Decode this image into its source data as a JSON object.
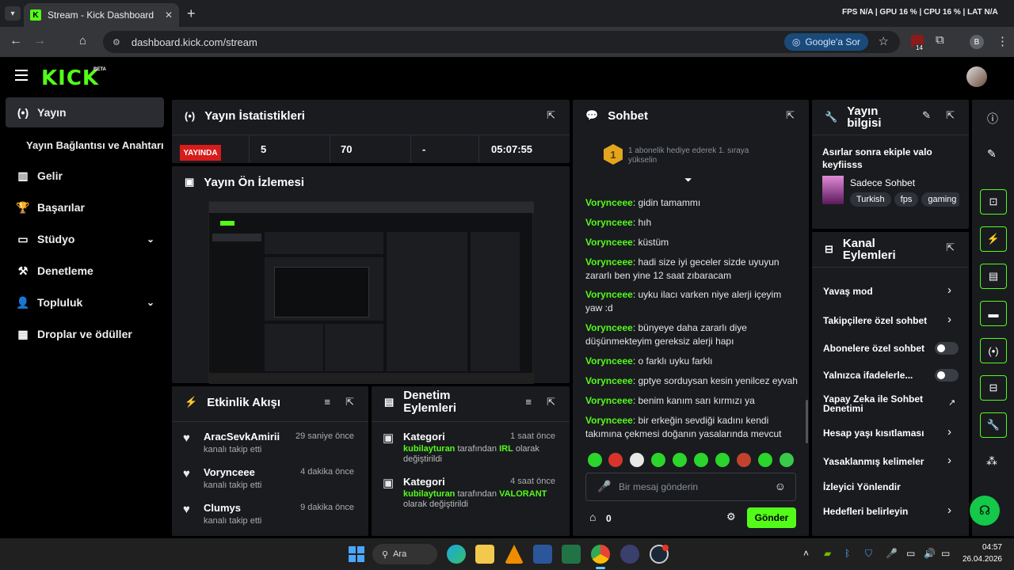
{
  "browser": {
    "tab_title": "Stream - Kick Dashboard",
    "url": "dashboard.kick.com/stream",
    "google_btn": "Google'a Sor",
    "badge_count": "14",
    "profile_letter": "B",
    "perf": "FPS N/A | GPU 16 % | CPU 16 % | LAT N/A"
  },
  "header": {
    "logo": "KICK",
    "beta": "BETA"
  },
  "sidebar": {
    "items": [
      {
        "label": "Yayın",
        "icon": "(•)"
      },
      {
        "label": "Yayın Bağlantısı ve Anahtarı",
        "icon": ""
      },
      {
        "label": "Gelir",
        "icon": "▥"
      },
      {
        "label": "Başarılar",
        "icon": "🏆"
      },
      {
        "label": "Stüdyo",
        "icon": "▭"
      },
      {
        "label": "Denetleme",
        "icon": "⚒"
      },
      {
        "label": "Topluluk",
        "icon": "👤"
      },
      {
        "label": "Droplar ve ödüller",
        "icon": "▦"
      }
    ]
  },
  "stats": {
    "title": "Yayın İstatistikleri",
    "live": "YAYINDA",
    "viewers": "5",
    "followers": "70",
    "subs": "-",
    "duration": "05:07:55"
  },
  "preview": {
    "title": "Yayın Ön İzlemesi"
  },
  "activity": {
    "title": "Etkinlik Akışı",
    "items": [
      {
        "name": "AracSevkAmirii",
        "sub": "kanalı takip etti",
        "time": "29 saniye önce"
      },
      {
        "name": "Vorynceee",
        "sub": "kanalı takip etti",
        "time": "4 dakika önce"
      },
      {
        "name": "Clumys",
        "sub": "kanalı takip etti",
        "time": "9 dakika önce"
      }
    ]
  },
  "moderation": {
    "title": "Denetim Eylemleri",
    "items": [
      {
        "title": "Kategori",
        "time": "1 saat önce",
        "user": "kubilayturan",
        "mid": " tarafından ",
        "cat": "IRL",
        "end": " olarak değiştirildi"
      },
      {
        "title": "Kategori",
        "time": "4 saat önce",
        "user": "kubilayturan",
        "mid": " tarafından ",
        "cat": "VALORANT",
        "end": " olarak değiştirildi"
      }
    ]
  },
  "chat": {
    "title": "Sohbet",
    "pinned_rank": "1",
    "pinned": "1 abonelik hediye ederek 1. sıraya yükselin",
    "messages": [
      {
        "user": "Vorynceee",
        "text": "gidin tamammı"
      },
      {
        "user": "Vorynceee",
        "text": "hıh"
      },
      {
        "user": "Vorynceee",
        "text": "küstüm"
      },
      {
        "user": "Vorynceee",
        "text": "hadi size iyi geceler sizde uyuyun zararlı ben yine 12 saat zıbaracam"
      },
      {
        "user": "Vorynceee",
        "text": "uyku ilacı varken niye alerji içeyim yaw :d"
      },
      {
        "user": "Vorynceee",
        "text": "bünyeye daha zararlı diye düşünmekteyim gereksiz alerji hapı"
      },
      {
        "user": "Vorynceee",
        "text": "o farklı uyku farklı"
      },
      {
        "user": "Vorynceee",
        "text": "gptye sorduysan kesin yenilcez eyvah"
      },
      {
        "user": "Vorynceee",
        "text": "benim kanım sarı kırmızı ya"
      },
      {
        "user": "Vorynceee",
        "text": "bir erkeğin sevdiği kadını kendi takımına çekmesi doğanın yasalarında mevcut"
      }
    ],
    "placeholder": "Bir mesaj gönderin",
    "points": "0",
    "send": "Gönder"
  },
  "streaminfo": {
    "title": "Yayın bilgisi",
    "stream_title": "Asırlar sonra ekiple valo keyfiisss",
    "category": "Sadece Sohbet",
    "tags": [
      "Turkish",
      "fps",
      "gaming"
    ]
  },
  "channel_actions": {
    "title": "Kanal Eylemleri",
    "items": [
      {
        "label": "Yavaş mod"
      },
      {
        "label": "Takipçilere özel sohbet"
      },
      {
        "label": "Abonelere özel sohbet"
      },
      {
        "label": "Yalnızca ifadelerle..."
      },
      {
        "label": "Yapay Zeka ile Sohbet Denetimi"
      },
      {
        "label": "Hesap yaşı kısıtlaması"
      },
      {
        "label": "Yasaklanmış kelimeler"
      },
      {
        "label": "İzleyici Yönlendir"
      },
      {
        "label": "Hedefleri belirleyin"
      }
    ]
  },
  "taskbar": {
    "search": "Ara",
    "time": "04:57",
    "date": "26.04.2026"
  }
}
